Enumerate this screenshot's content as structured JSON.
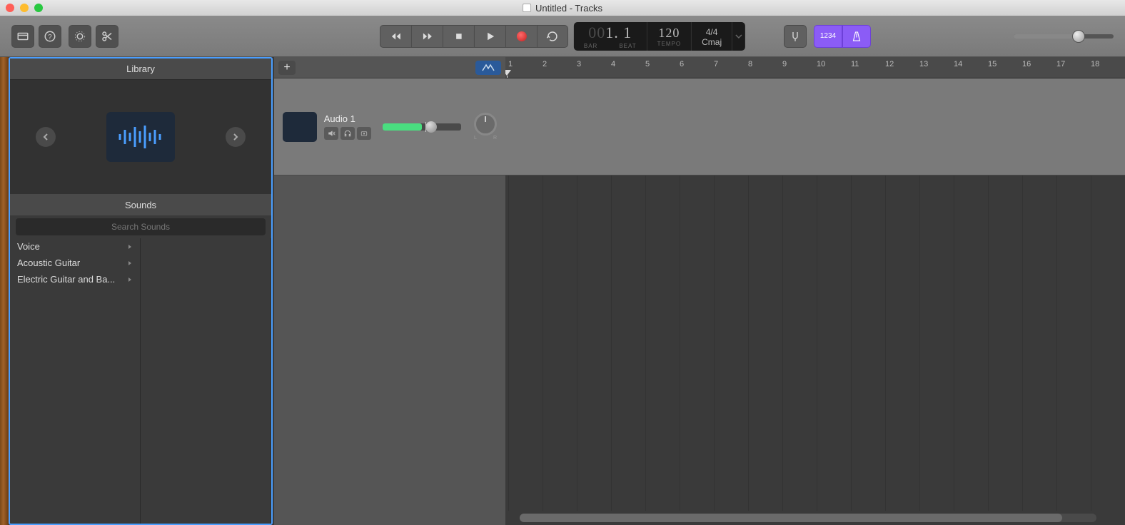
{
  "window": {
    "title": "Untitled - Tracks"
  },
  "lcd": {
    "bar_dim": "00",
    "bar": "1. 1",
    "bar_label": "BAR",
    "beat_label": "BEAT",
    "tempo": "120",
    "tempo_label": "TEMPO",
    "sig": "4/4",
    "key": "Cmaj"
  },
  "count_in": "1234",
  "library": {
    "title": "Library",
    "sounds_title": "Sounds",
    "search_placeholder": "Search Sounds",
    "categories": [
      "Voice",
      "Acoustic Guitar",
      "Electric Guitar and Ba..."
    ]
  },
  "track": {
    "name": "Audio 1",
    "pan_l": "L",
    "pan_r": "R"
  },
  "ruler": {
    "start": 1,
    "end": 18
  }
}
